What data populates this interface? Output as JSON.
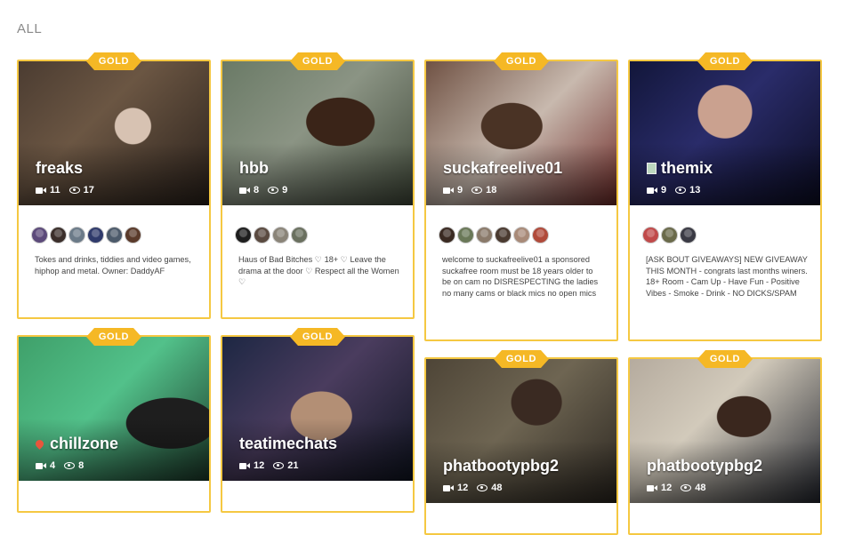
{
  "section": {
    "title": "ALL"
  },
  "cards": [
    {
      "badge": "GOLD",
      "name": "freaks",
      "cams": "11",
      "viewers": "17",
      "avatar_colors": [
        "#5c4a7a",
        "#3a2e2a",
        "#6b7a88",
        "#2f3a6b",
        "#4c5a6a",
        "#5a3a2a"
      ],
      "description": "Tokes and drinks, tiddies and video games, hiphop and metal. Owner: DaddyAF"
    },
    {
      "badge": "GOLD",
      "name": "hbb",
      "cams": "8",
      "viewers": "9",
      "avatar_colors": [
        "#1e1e1e",
        "#5a4a40",
        "#8a8478",
        "#6a705f"
      ],
      "description": "Haus of Bad Bitches ♡ 18+ ♡ Leave the drama at the door ♡ Respect all the Women ♡"
    },
    {
      "badge": "GOLD",
      "name": "suckafreelive01",
      "cams": "9",
      "viewers": "18",
      "avatar_colors": [
        "#3a2a22",
        "#6a7858",
        "#8a7a6a",
        "#4a3a30",
        "#a88a78",
        "#b04a3a"
      ],
      "description": "welcome to suckafreelive01 a sponsored suckafree room must be 18 years older to be on cam no DISRESPECTING the ladies no many cams or black mics no open mics"
    },
    {
      "badge": "GOLD",
      "name": "themix",
      "cams": "9",
      "viewers": "13",
      "avatar_colors": [
        "#c04a4a",
        "#6a6a4a",
        "#3a3a44"
      ],
      "description": "[ASK BOUT GIVEAWAYS] NEW GIVEAWAY THIS MONTH - congrats last months winers. 18+ Room - Cam Up - Have Fun - Positive Vibes - Smoke - Drink - NO DICKS/SPAM"
    },
    {
      "badge": "GOLD",
      "name": "chillzone",
      "cams": "4",
      "viewers": "8"
    },
    {
      "badge": "GOLD",
      "name": "teatimechats",
      "cams": "12",
      "viewers": "21"
    },
    {
      "badge": "GOLD",
      "name": "phatbootypbg2",
      "cams": "12",
      "viewers": "48"
    },
    {
      "badge": "GOLD",
      "name": "phatbootypbg2",
      "cams": "12",
      "viewers": "48"
    }
  ]
}
